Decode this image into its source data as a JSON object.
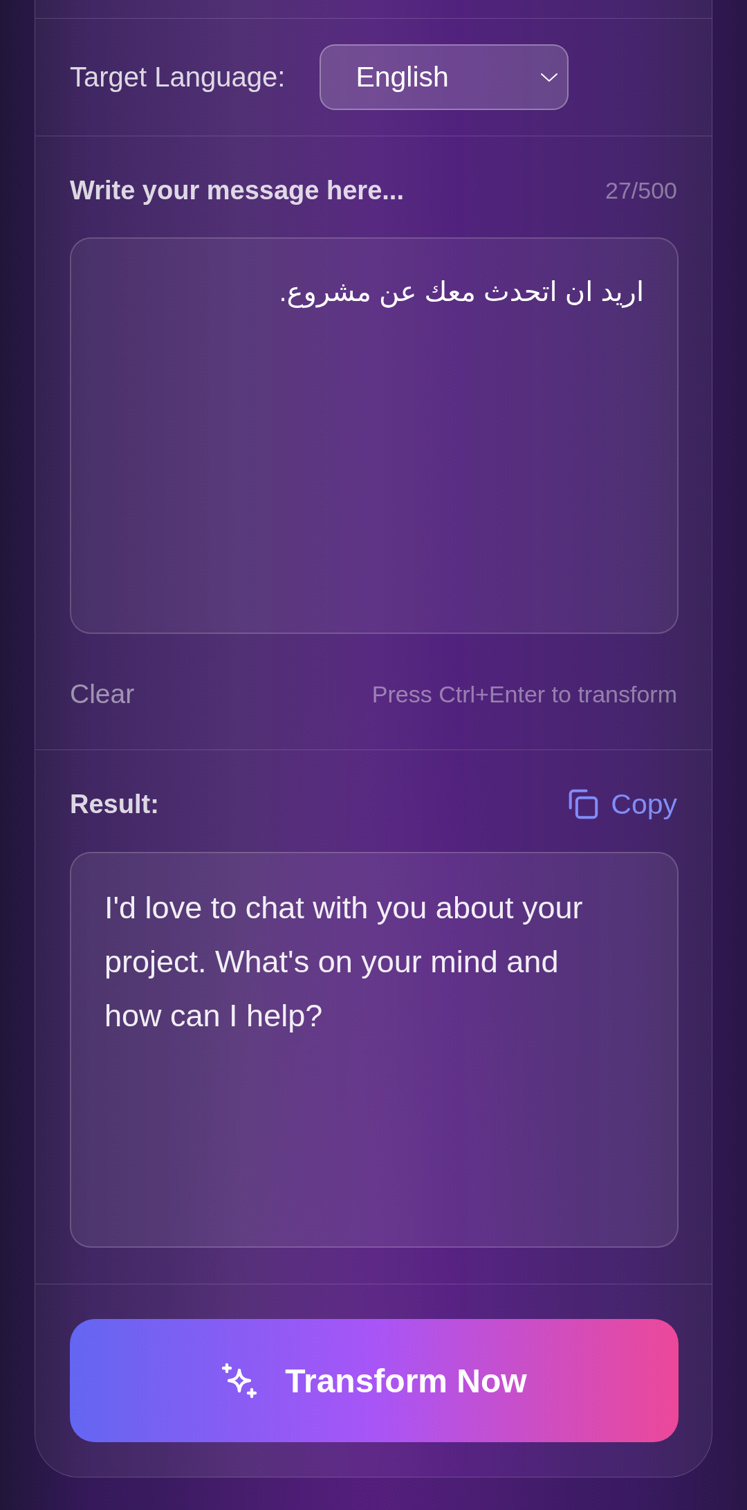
{
  "language": {
    "label": "Target Language:",
    "value": "English"
  },
  "message": {
    "label": "Write your message here...",
    "counter": "27/500",
    "value": "اريد ان اتحدث معك عن مشروع.",
    "clear": "Clear",
    "hint": "Press Ctrl+Enter to transform"
  },
  "result": {
    "label": "Result:",
    "copy": "Copy",
    "text": "I'd love to chat with you about your project. What's on your mind and how can I help?"
  },
  "action": {
    "label": "Transform Now"
  }
}
